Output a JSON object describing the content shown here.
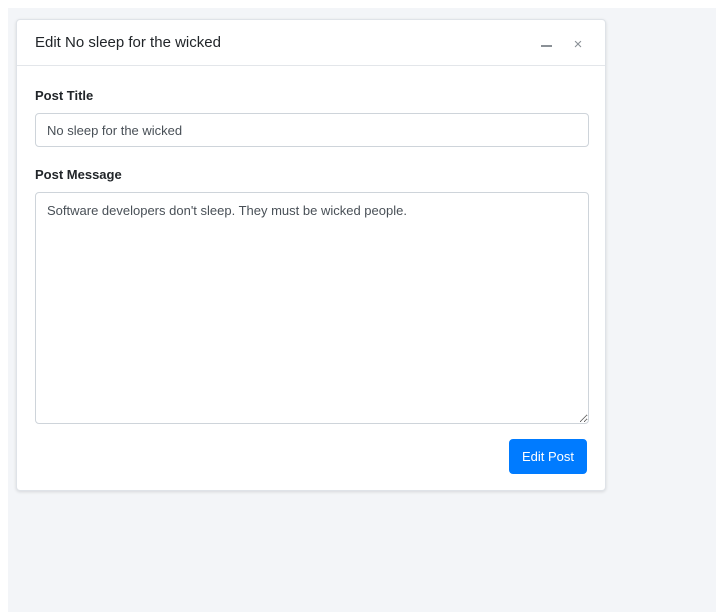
{
  "card": {
    "title": "Edit No sleep for the wicked",
    "tools": {
      "minimize_icon": "minus-icon",
      "close_icon": "close-icon",
      "close_glyph": "×"
    }
  },
  "form": {
    "title_label": "Post Title",
    "title_value": "No sleep for the wicked",
    "message_label": "Post Message",
    "message_value": "Software developers don't sleep. They must be wicked people.",
    "submit_label": "Edit Post"
  },
  "colors": {
    "accent": "#007bff",
    "page_background": "#f3f5f8",
    "border": "#ced4da"
  }
}
